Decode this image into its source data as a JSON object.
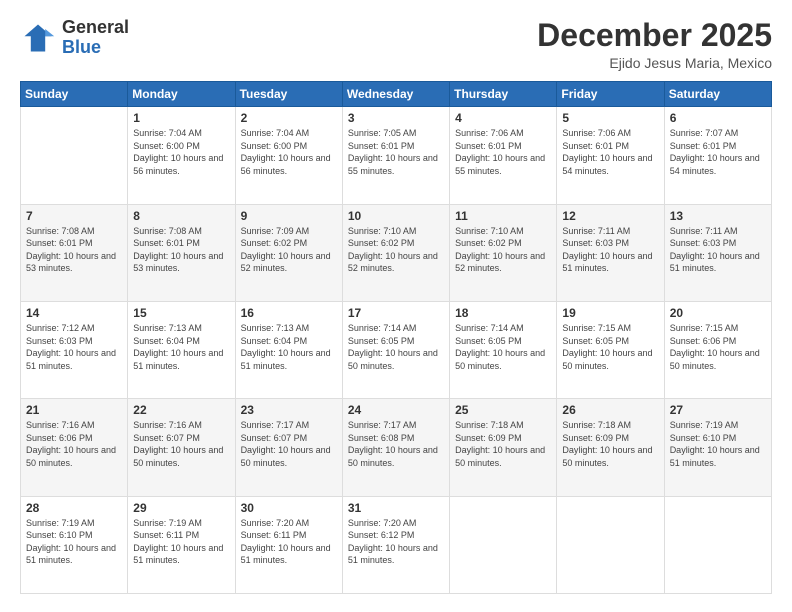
{
  "logo": {
    "general": "General",
    "blue": "Blue"
  },
  "header": {
    "month": "December 2025",
    "location": "Ejido Jesus Maria, Mexico"
  },
  "weekdays": [
    "Sunday",
    "Monday",
    "Tuesday",
    "Wednesday",
    "Thursday",
    "Friday",
    "Saturday"
  ],
  "weeks": [
    [
      {
        "day": "",
        "sunrise": "",
        "sunset": "",
        "daylight": ""
      },
      {
        "day": "1",
        "sunrise": "Sunrise: 7:04 AM",
        "sunset": "Sunset: 6:00 PM",
        "daylight": "Daylight: 10 hours and 56 minutes."
      },
      {
        "day": "2",
        "sunrise": "Sunrise: 7:04 AM",
        "sunset": "Sunset: 6:00 PM",
        "daylight": "Daylight: 10 hours and 56 minutes."
      },
      {
        "day": "3",
        "sunrise": "Sunrise: 7:05 AM",
        "sunset": "Sunset: 6:01 PM",
        "daylight": "Daylight: 10 hours and 55 minutes."
      },
      {
        "day": "4",
        "sunrise": "Sunrise: 7:06 AM",
        "sunset": "Sunset: 6:01 PM",
        "daylight": "Daylight: 10 hours and 55 minutes."
      },
      {
        "day": "5",
        "sunrise": "Sunrise: 7:06 AM",
        "sunset": "Sunset: 6:01 PM",
        "daylight": "Daylight: 10 hours and 54 minutes."
      },
      {
        "day": "6",
        "sunrise": "Sunrise: 7:07 AM",
        "sunset": "Sunset: 6:01 PM",
        "daylight": "Daylight: 10 hours and 54 minutes."
      }
    ],
    [
      {
        "day": "7",
        "sunrise": "Sunrise: 7:08 AM",
        "sunset": "Sunset: 6:01 PM",
        "daylight": "Daylight: 10 hours and 53 minutes."
      },
      {
        "day": "8",
        "sunrise": "Sunrise: 7:08 AM",
        "sunset": "Sunset: 6:01 PM",
        "daylight": "Daylight: 10 hours and 53 minutes."
      },
      {
        "day": "9",
        "sunrise": "Sunrise: 7:09 AM",
        "sunset": "Sunset: 6:02 PM",
        "daylight": "Daylight: 10 hours and 52 minutes."
      },
      {
        "day": "10",
        "sunrise": "Sunrise: 7:10 AM",
        "sunset": "Sunset: 6:02 PM",
        "daylight": "Daylight: 10 hours and 52 minutes."
      },
      {
        "day": "11",
        "sunrise": "Sunrise: 7:10 AM",
        "sunset": "Sunset: 6:02 PM",
        "daylight": "Daylight: 10 hours and 52 minutes."
      },
      {
        "day": "12",
        "sunrise": "Sunrise: 7:11 AM",
        "sunset": "Sunset: 6:03 PM",
        "daylight": "Daylight: 10 hours and 51 minutes."
      },
      {
        "day": "13",
        "sunrise": "Sunrise: 7:11 AM",
        "sunset": "Sunset: 6:03 PM",
        "daylight": "Daylight: 10 hours and 51 minutes."
      }
    ],
    [
      {
        "day": "14",
        "sunrise": "Sunrise: 7:12 AM",
        "sunset": "Sunset: 6:03 PM",
        "daylight": "Daylight: 10 hours and 51 minutes."
      },
      {
        "day": "15",
        "sunrise": "Sunrise: 7:13 AM",
        "sunset": "Sunset: 6:04 PM",
        "daylight": "Daylight: 10 hours and 51 minutes."
      },
      {
        "day": "16",
        "sunrise": "Sunrise: 7:13 AM",
        "sunset": "Sunset: 6:04 PM",
        "daylight": "Daylight: 10 hours and 51 minutes."
      },
      {
        "day": "17",
        "sunrise": "Sunrise: 7:14 AM",
        "sunset": "Sunset: 6:05 PM",
        "daylight": "Daylight: 10 hours and 50 minutes."
      },
      {
        "day": "18",
        "sunrise": "Sunrise: 7:14 AM",
        "sunset": "Sunset: 6:05 PM",
        "daylight": "Daylight: 10 hours and 50 minutes."
      },
      {
        "day": "19",
        "sunrise": "Sunrise: 7:15 AM",
        "sunset": "Sunset: 6:05 PM",
        "daylight": "Daylight: 10 hours and 50 minutes."
      },
      {
        "day": "20",
        "sunrise": "Sunrise: 7:15 AM",
        "sunset": "Sunset: 6:06 PM",
        "daylight": "Daylight: 10 hours and 50 minutes."
      }
    ],
    [
      {
        "day": "21",
        "sunrise": "Sunrise: 7:16 AM",
        "sunset": "Sunset: 6:06 PM",
        "daylight": "Daylight: 10 hours and 50 minutes."
      },
      {
        "day": "22",
        "sunrise": "Sunrise: 7:16 AM",
        "sunset": "Sunset: 6:07 PM",
        "daylight": "Daylight: 10 hours and 50 minutes."
      },
      {
        "day": "23",
        "sunrise": "Sunrise: 7:17 AM",
        "sunset": "Sunset: 6:07 PM",
        "daylight": "Daylight: 10 hours and 50 minutes."
      },
      {
        "day": "24",
        "sunrise": "Sunrise: 7:17 AM",
        "sunset": "Sunset: 6:08 PM",
        "daylight": "Daylight: 10 hours and 50 minutes."
      },
      {
        "day": "25",
        "sunrise": "Sunrise: 7:18 AM",
        "sunset": "Sunset: 6:09 PM",
        "daylight": "Daylight: 10 hours and 50 minutes."
      },
      {
        "day": "26",
        "sunrise": "Sunrise: 7:18 AM",
        "sunset": "Sunset: 6:09 PM",
        "daylight": "Daylight: 10 hours and 50 minutes."
      },
      {
        "day": "27",
        "sunrise": "Sunrise: 7:19 AM",
        "sunset": "Sunset: 6:10 PM",
        "daylight": "Daylight: 10 hours and 51 minutes."
      }
    ],
    [
      {
        "day": "28",
        "sunrise": "Sunrise: 7:19 AM",
        "sunset": "Sunset: 6:10 PM",
        "daylight": "Daylight: 10 hours and 51 minutes."
      },
      {
        "day": "29",
        "sunrise": "Sunrise: 7:19 AM",
        "sunset": "Sunset: 6:11 PM",
        "daylight": "Daylight: 10 hours and 51 minutes."
      },
      {
        "day": "30",
        "sunrise": "Sunrise: 7:20 AM",
        "sunset": "Sunset: 6:11 PM",
        "daylight": "Daylight: 10 hours and 51 minutes."
      },
      {
        "day": "31",
        "sunrise": "Sunrise: 7:20 AM",
        "sunset": "Sunset: 6:12 PM",
        "daylight": "Daylight: 10 hours and 51 minutes."
      },
      {
        "day": "",
        "sunrise": "",
        "sunset": "",
        "daylight": ""
      },
      {
        "day": "",
        "sunrise": "",
        "sunset": "",
        "daylight": ""
      },
      {
        "day": "",
        "sunrise": "",
        "sunset": "",
        "daylight": ""
      }
    ]
  ]
}
